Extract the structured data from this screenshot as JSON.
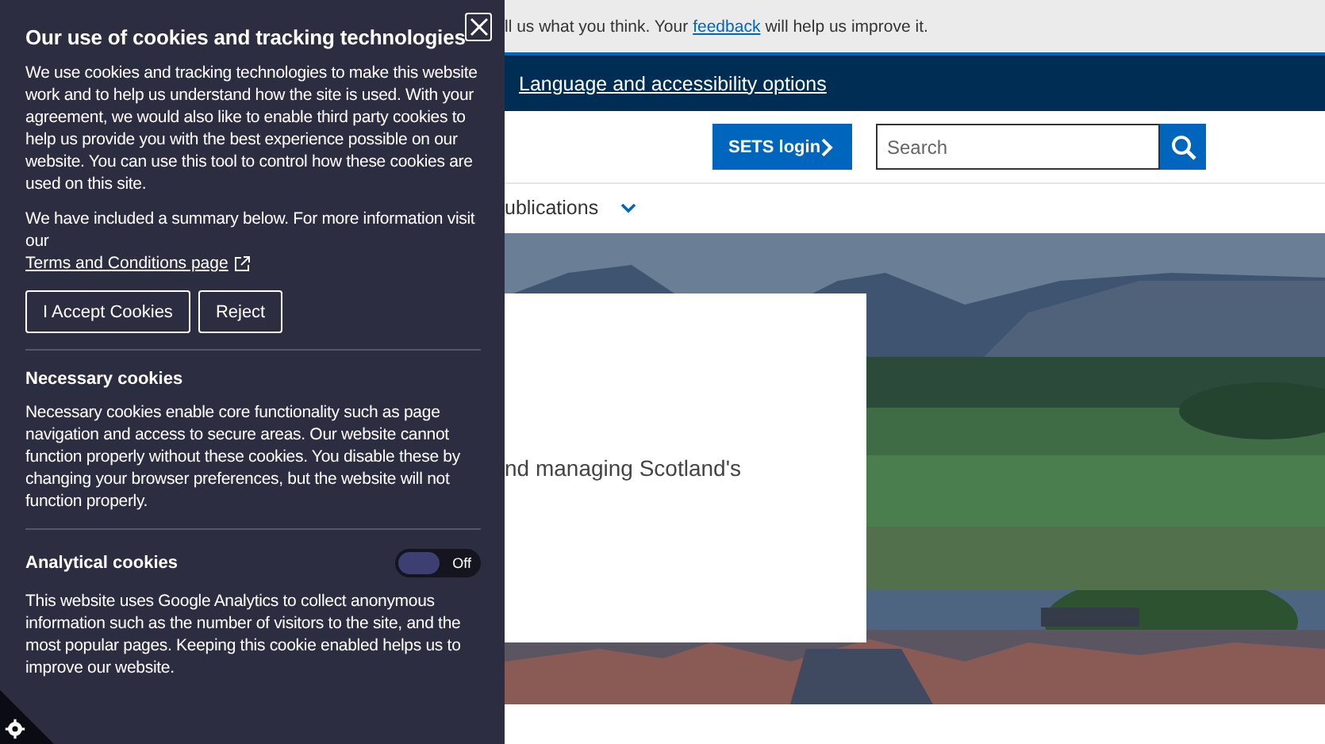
{
  "cookie_panel": {
    "title": "Our use of cookies and tracking technologies",
    "intro": "We use cookies and tracking technologies to make this website work and to help us understand how the site is used. With your agreement, we would also like to enable third party cookies to help us provide you with the best experience possible on our website. You can use this tool to control how these cookies are used on this site.",
    "summary_text": "We have included a summary below. For more information visit our",
    "terms_link": "Terms and Conditions page",
    "buttons": [
      "I Accept Cookies",
      "Reject"
    ],
    "sections": [
      {
        "kind": "text",
        "title": "Necessary cookies",
        "body": "Necessary cookies enable core functionality such as page navigation and access to secure areas. Our website cannot function properly without these cookies. You disable these by changing your browser preferences, but the website will not function properly."
      },
      {
        "kind": "toggle",
        "title": "Analytical cookies",
        "on": false,
        "toggle_label": "Off",
        "body": "This website uses Google Analytics to collect anonymous information such as the number of visitors to the site, and the most popular pages. Keeping this cookie enabled helps us to improve our website."
      }
    ]
  },
  "feedback_bar": {
    "text_before": "ll us what you think. Your",
    "link": "feedback",
    "text_after": "will help us improve it."
  },
  "top_nav": {
    "link": "Language and accessibility options"
  },
  "header": {
    "login_button": "SETS login",
    "search": {
      "placeholder": "Search"
    }
  },
  "menu": {
    "item": "ublications"
  },
  "hero": {
    "kind": "picture",
    "card_text": "nd managing Scotland's"
  }
}
